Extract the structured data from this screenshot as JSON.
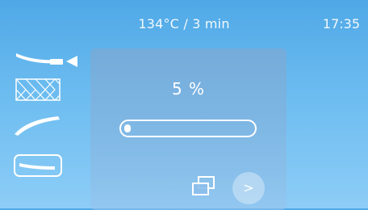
{
  "status_bar": {
    "program": "134°C / 3 min",
    "time": "17:35"
  },
  "sidebar": {
    "items": [
      {
        "icon": "straight-handpiece-icon",
        "selected": true
      },
      {
        "icon": "tray-icon",
        "selected": false
      },
      {
        "icon": "contra-angle-handpiece-icon",
        "selected": false
      },
      {
        "icon": "turbine-handpiece-icon",
        "selected": false
      }
    ]
  },
  "main_panel": {
    "progress_label": "5 %",
    "progress_fraction": 0.05,
    "next_label": ">"
  },
  "colors": {
    "background_top": "#4fa8e6",
    "background_bottom": "#8dcdf7",
    "foreground": "#ffffff"
  }
}
